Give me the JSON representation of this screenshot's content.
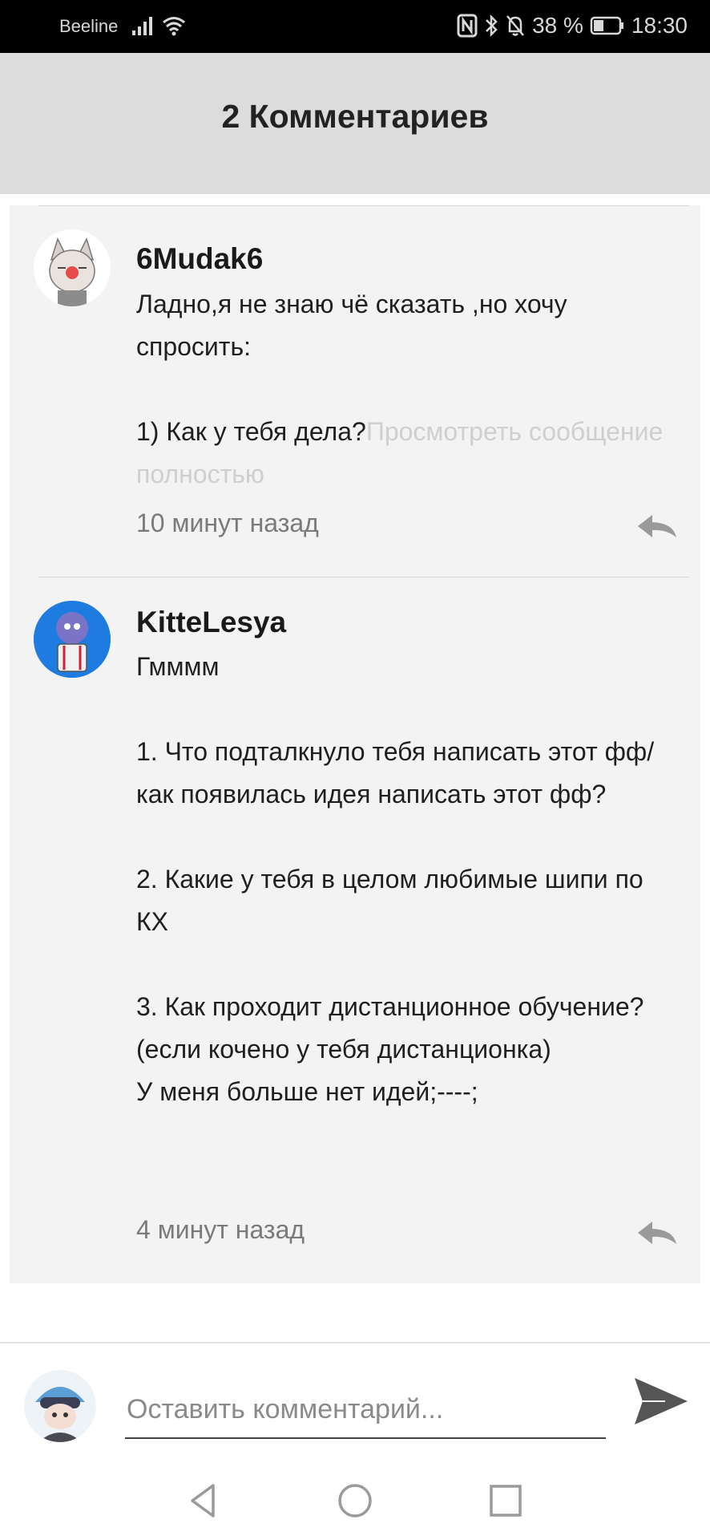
{
  "status_bar": {
    "carrier": "Beeline",
    "battery": "38 %",
    "time": "18:30",
    "icons": [
      "signal-icon",
      "wifi-icon",
      "nfc-icon",
      "bluetooth-icon",
      "bell-off-icon",
      "battery-icon"
    ]
  },
  "header": {
    "title": "2 Комментариев"
  },
  "comments": [
    {
      "author": "6Mudak6",
      "text": "Ладно,я не знаю чё сказать ,но хочу спросить:\n\n1) Как у тебя дела?",
      "more_label": "Просмотреть сообщение полностью",
      "time": "10 минут назад"
    },
    {
      "author": "KitteLesya",
      "text": "Гмммм\n\n1. Что подталкнуло тебя написать этот фф/как появилась идея написать этот фф?\n\n2. Какие у тебя в целом любимые шипи по КХ\n\n3. Как проходит дистанционное обучение?(если кочено у тебя дистанционка)\nУ меня больше нет идей;----;",
      "time": "4 минут назад"
    }
  ],
  "input": {
    "placeholder": "Оставить комментарий...",
    "value": ""
  },
  "colors": {
    "header_bg": "#dcdcdc",
    "card_bg": "#f3f3f4",
    "more_link": "#cfcfcf",
    "time": "#7a7a7a"
  }
}
